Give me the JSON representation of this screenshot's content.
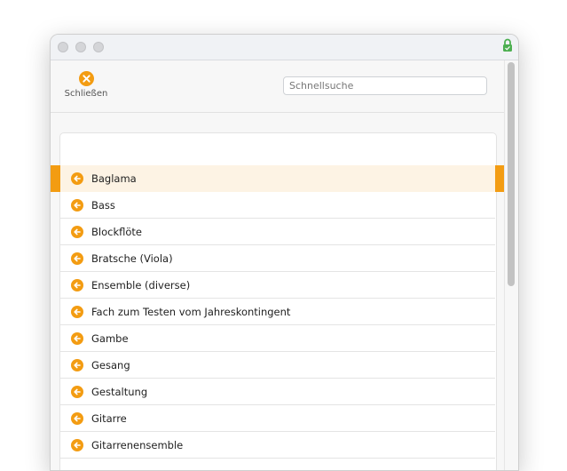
{
  "toolbar": {
    "close_label": "Schließen",
    "search_placeholder": "Schnellsuche"
  },
  "list": {
    "items": [
      {
        "label": "Baglama",
        "selected": true
      },
      {
        "label": "Bass"
      },
      {
        "label": "Blockflöte"
      },
      {
        "label": "Bratsche (Viola)"
      },
      {
        "label": "Ensemble (diverse)"
      },
      {
        "label": "Fach zum Testen vom Jahreskontingent"
      },
      {
        "label": "Gambe"
      },
      {
        "label": "Gesang"
      },
      {
        "label": "Gestaltung"
      },
      {
        "label": "Gitarre"
      },
      {
        "label": "Gitarrenensemble"
      }
    ],
    "item_icon": "arrow-left-circle-icon"
  },
  "colors": {
    "accent": "#f39c12",
    "selected_row_bg": "#fdf3e4",
    "lock_green": "#4caf50"
  }
}
